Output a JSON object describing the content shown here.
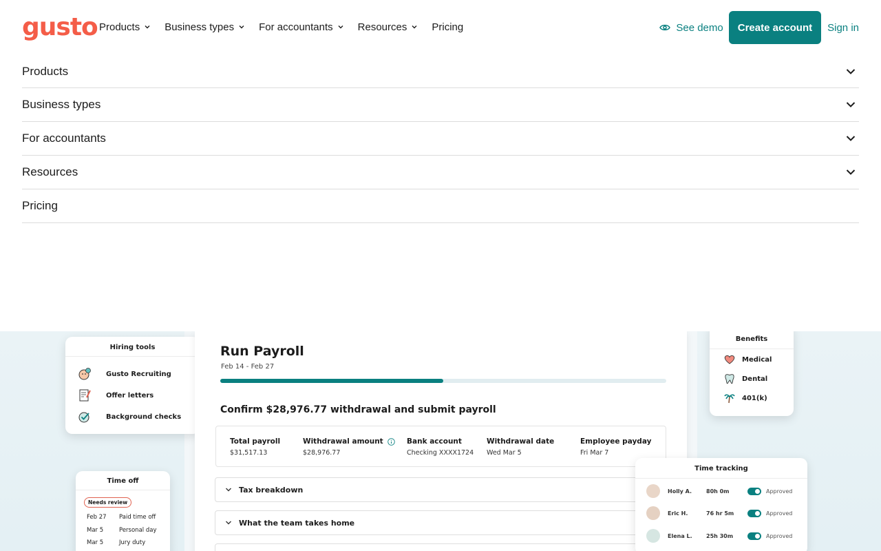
{
  "header": {
    "logo": "gusto",
    "nav": [
      "Products",
      "Business types",
      "For accountants",
      "Resources",
      "Pricing"
    ],
    "see_demo": "See demo",
    "create_account": "Create account",
    "sign_in": "Sign in"
  },
  "menu": {
    "items": [
      "Products",
      "Business types",
      "For accountants",
      "Resources",
      "Pricing"
    ]
  },
  "colors": {
    "brand_coral": "#f45d48",
    "brand_teal": "#0a8080"
  },
  "preview": {
    "hiring": {
      "title": "Hiring tools",
      "items": [
        "Gusto Recruiting",
        "Offer letters",
        "Background checks"
      ]
    },
    "timeoff": {
      "title": "Time off",
      "badge": "Needs review",
      "rows": [
        {
          "date": "Feb 27",
          "type": "Paid time off"
        },
        {
          "date": "Mar 5",
          "type": "Personal day"
        },
        {
          "date": "Mar 5",
          "type": "Jury duty"
        }
      ]
    },
    "payroll": {
      "title": "Run Payroll",
      "dates": "Feb 14 - Feb 27",
      "progress": 0.5,
      "confirm": "Confirm $28,976.77 withdrawal and submit payroll",
      "summary": [
        {
          "label": "Total payroll",
          "value": "$31,517.13"
        },
        {
          "label": "Withdrawal amount",
          "value": "$28,976.77"
        },
        {
          "label": "Bank account",
          "value": "Checking XXXX1724"
        },
        {
          "label": "Withdrawal date",
          "value": "Wed Mar 5"
        },
        {
          "label": "Employee payday",
          "value": "Fri Mar 7"
        }
      ],
      "accordions": [
        "Tax breakdown",
        "What the team takes home"
      ]
    },
    "benefits": {
      "title": "Benefits",
      "items": [
        "Medical",
        "Dental",
        "401(k)"
      ]
    },
    "time_tracking": {
      "title": "Time tracking",
      "rows": [
        {
          "name": "Holly A.",
          "hours": "80h 0m",
          "status": "Approved"
        },
        {
          "name": "Eric H.",
          "hours": "76 hr 5m",
          "status": "Approved"
        },
        {
          "name": "Elena L.",
          "hours": "25h 30m",
          "status": "Approved"
        }
      ]
    }
  }
}
